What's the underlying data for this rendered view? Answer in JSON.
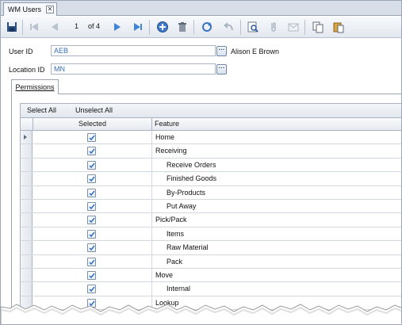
{
  "document_tab": {
    "title": "WM Users",
    "close_glyph": "✕"
  },
  "toolbar": {
    "record_current": "1",
    "record_of": "of 4",
    "icons": [
      "save-icon",
      "first-record-icon",
      "previous-record-icon",
      "next-record-icon",
      "last-record-icon",
      "add-icon",
      "delete-icon",
      "refresh-icon",
      "undo-icon",
      "find-icon",
      "attachment-icon",
      "email-icon",
      "copy-icon",
      "paste-icon"
    ]
  },
  "form": {
    "user_id_label": "User ID",
    "user_id_value": "AEB",
    "user_name": "Alison E Brown",
    "location_id_label": "Location ID",
    "location_id_value": "MN",
    "lookup_glyph": "···"
  },
  "tabs": [
    {
      "label": "Permissions",
      "active": true
    }
  ],
  "grid": {
    "select_all_label": "Select All",
    "unselect_all_label": "Unselect All",
    "columns": [
      "Selected",
      "Feature"
    ],
    "rows": [
      {
        "feature": "Home",
        "level": 0,
        "selected": true,
        "current": true
      },
      {
        "feature": "Receiving",
        "level": 0,
        "selected": true
      },
      {
        "feature": "Receive Orders",
        "level": 1,
        "selected": true
      },
      {
        "feature": "Finished Goods",
        "level": 1,
        "selected": true
      },
      {
        "feature": "By-Products",
        "level": 1,
        "selected": true
      },
      {
        "feature": "Put Away",
        "level": 1,
        "selected": true
      },
      {
        "feature": "Pick/Pack",
        "level": 0,
        "selected": true
      },
      {
        "feature": "Items",
        "level": 1,
        "selected": true
      },
      {
        "feature": "Raw Material",
        "level": 1,
        "selected": true
      },
      {
        "feature": "Pack",
        "level": 1,
        "selected": true
      },
      {
        "feature": "Move",
        "level": 0,
        "selected": true
      },
      {
        "feature": "Internal",
        "level": 1,
        "selected": true
      },
      {
        "feature": "Lookup",
        "level": 0,
        "selected": true
      }
    ]
  },
  "colors": {
    "field_text": "#3a6fb8",
    "checkmark": "#2a6cc4",
    "nav_arrow": "#3f86d8"
  }
}
